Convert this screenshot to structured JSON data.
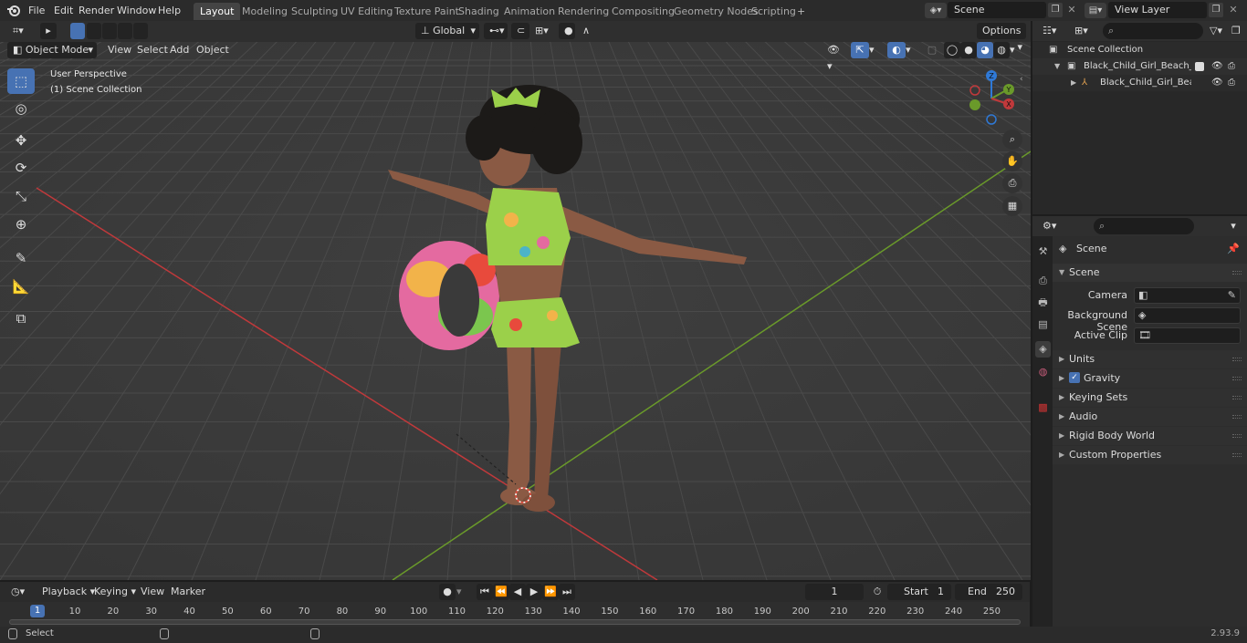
{
  "topbar": {
    "menus": [
      "File",
      "Edit",
      "Render",
      "Window",
      "Help"
    ],
    "workspaces": [
      "Layout",
      "Modeling",
      "Sculpting",
      "UV Editing",
      "Texture Paint",
      "Shading",
      "Animation",
      "Rendering",
      "Compositing",
      "Geometry Nodes",
      "Scripting"
    ],
    "active_workspace": "Layout",
    "add_tab": "+",
    "scene_name": "Scene",
    "view_layer_name": "View Layer"
  },
  "viewport_header": {
    "mode": "Object Mode",
    "menus": [
      "View",
      "Select",
      "Add",
      "Object"
    ],
    "transform_orientation": "Global",
    "options_label": "Options"
  },
  "viewport": {
    "perspective_label": "User Perspective",
    "collection_label": "(1) Scene Collection",
    "gizmo_axes": [
      "Z",
      "Y",
      "X"
    ]
  },
  "timeline": {
    "menus": [
      "Playback",
      "Keying",
      "View",
      "Marker"
    ],
    "current_frame": "1",
    "start_label": "Start",
    "start_value": "1",
    "end_label": "End",
    "end_value": "250",
    "ruler": [
      "1",
      "10",
      "20",
      "30",
      "40",
      "50",
      "60",
      "70",
      "80",
      "90",
      "100",
      "110",
      "120",
      "130",
      "140",
      "150",
      "160",
      "170",
      "180",
      "190",
      "200",
      "210",
      "220",
      "230",
      "240",
      "250"
    ]
  },
  "statusbar": {
    "select_label": "Select",
    "version": "2.93.9"
  },
  "outliner": {
    "rows": [
      {
        "label": "Scene Collection"
      },
      {
        "label": "Black_Child_Girl_Beach_Style"
      },
      {
        "label": "Black_Child_Girl_Beach_S"
      }
    ]
  },
  "properties": {
    "context_title": "Scene",
    "panel_title": "Scene",
    "camera_label": "Camera",
    "background_scene_label": "Background Scene",
    "active_clip_label": "Active Clip",
    "subpanels": [
      "Units",
      "Gravity",
      "Keying Sets",
      "Audio",
      "Rigid Body World",
      "Custom Properties"
    ],
    "gravity_checked": true
  },
  "colors": {
    "accent": "#4772b3",
    "x_axis": "#c0393b",
    "y_axis": "#6a9a2a",
    "z_axis": "#2f79d6"
  }
}
